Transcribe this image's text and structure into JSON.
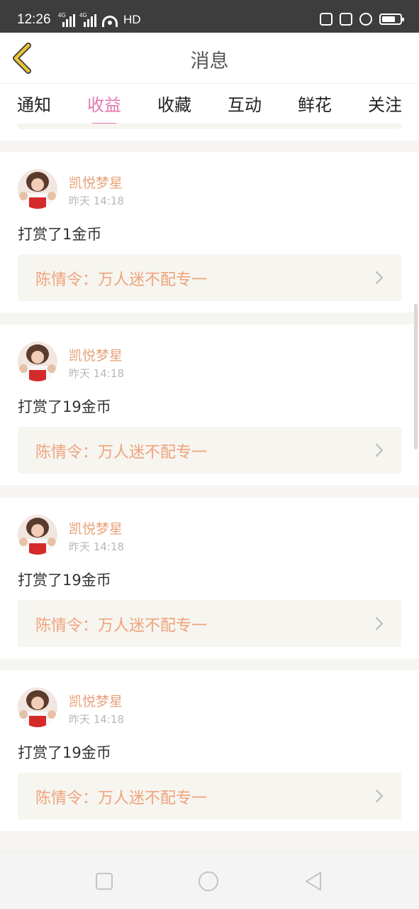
{
  "status_bar": {
    "time": "12:26",
    "signal1_label": "4G",
    "signal2_label": "4G",
    "hd_label": "HD",
    "icons": [
      "nfc-icon",
      "mute-icon",
      "alarm-icon",
      "battery-icon"
    ]
  },
  "header": {
    "title": "消息",
    "back_icon": "chevron-left-icon"
  },
  "tabs": [
    {
      "label": "通知",
      "active": false
    },
    {
      "label": "收益",
      "active": true
    },
    {
      "label": "收藏",
      "active": false
    },
    {
      "label": "互动",
      "active": false
    },
    {
      "label": "鲜花",
      "active": false
    },
    {
      "label": "关注",
      "active": false
    }
  ],
  "messages": [
    {
      "user": "凯悦梦星",
      "time": "昨天 14:18",
      "text": "打赏了1金币",
      "link": "陈情令：万人迷不配专一"
    },
    {
      "user": "凯悦梦星",
      "time": "昨天 14:18",
      "text": "打赏了19金币",
      "link": "陈情令：万人迷不配专一"
    },
    {
      "user": "凯悦梦星",
      "time": "昨天 14:18",
      "text": "打赏了19金币",
      "link": "陈情令：万人迷不配专一"
    },
    {
      "user": "凯悦梦星",
      "time": "昨天 14:18",
      "text": "打赏了19金币",
      "link": "陈情令：万人迷不配专一"
    }
  ],
  "colors": {
    "accent": "#e278b0",
    "username": "#e8a27a",
    "link_text": "#f0a27c",
    "back_icon": "#e9c437"
  },
  "nav_bar": {
    "icons": [
      "square-icon",
      "circle-icon",
      "triangle-back-icon"
    ]
  }
}
